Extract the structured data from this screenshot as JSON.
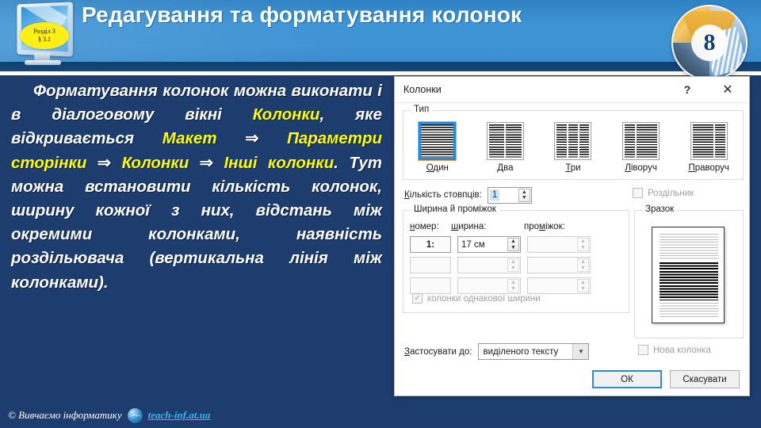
{
  "header": {
    "title": "Редагування та форматування колонок",
    "logo": {
      "line1": "Розділ 3",
      "line2": "§ 3.1"
    },
    "badge_number": "8"
  },
  "body": {
    "paragraph_plain": "Форматування колонок можна виконати і в діалоговому вікні Колонки, яке відкривається Макет ⇒ Параметри сторінки ⇒ Колонки ⇒ Інші колонки. Тут можна встановити кількість колонок, ширину кожної з них, відстань між окремими колонками, наявність роздільювача (вертикальна лінія між колонками).",
    "seg1": "Форматування колонок можна виконати і в діалоговому вікні ",
    "hl1": "Колонки",
    "seg2": ", яке відкривається ",
    "hl2": "Макет",
    "arr1": " ⇒ ",
    "hl3": "Параметри сторінки",
    "arr2": " ⇒ ",
    "hl4": "Колонки",
    "arr3": " ⇒ ",
    "hl5": "Інші колонки",
    "seg3": ". Тут можна встановити кількість колонок, ширину кожної з них, відстань між окремими колонками, наявність роздільювача (вертикальна лінія між колонками)."
  },
  "footer": {
    "copyright": "© Вивчаємо інформатику",
    "site": "teach-inf.at.ua"
  },
  "dialog": {
    "title": "Колонки",
    "help_glyph": "?",
    "close_glyph": "✕",
    "type_group_label": "Тип",
    "presets": [
      {
        "label": "Один",
        "underline": "О",
        "rest": "дин",
        "columns": 1,
        "selected": true
      },
      {
        "label": "Два",
        "underline": "Д",
        "rest": "ва",
        "columns": 2,
        "selected": false
      },
      {
        "label": "Три",
        "underline": "Т",
        "rest": "ри",
        "columns": 3,
        "selected": false
      },
      {
        "label": "Ліворуч",
        "underline": "Л",
        "rest": "іворуч",
        "columns": 2,
        "selected": false
      },
      {
        "label": "Праворуч",
        "underline": "П",
        "rest": "раворуч",
        "columns": 2,
        "selected": false
      }
    ],
    "column_count": {
      "label_underline": "К",
      "label_rest": "ількість стовпців:",
      "value": "1"
    },
    "separator_checkbox": {
      "label": "Роздільник",
      "checked": false,
      "enabled": false
    },
    "width_group_label": "Ширина й проміжок",
    "width_headers": {
      "number_u": "н",
      "number_rest": "омер:",
      "width_u": "ш",
      "width_rest": "ирина:",
      "gap_u": "про",
      "gap_mid": "м",
      "gap_rest": "іжок:"
    },
    "width_rows": [
      {
        "number": "1:",
        "width": "17 см",
        "gap": "",
        "enabled": true
      },
      {
        "number": "",
        "width": "",
        "gap": "",
        "enabled": false
      },
      {
        "number": "",
        "width": "",
        "gap": "",
        "enabled": false
      }
    ],
    "equal_width_checkbox": {
      "label": "колонки однакової ширини",
      "checked": true,
      "enabled": false
    },
    "sample_group_label": "Зразок",
    "apply_to": {
      "label_underline": "З",
      "label_rest": "астосувати до:",
      "value": "виділеного тексту"
    },
    "new_column_checkbox": {
      "label": "Нова колонка",
      "checked": false,
      "enabled": false
    },
    "ok_button": "ОК",
    "cancel_button": "Скасувати",
    "spin_up_glyph": "▲",
    "spin_down_glyph": "▼",
    "dropdown_glyph": "▼",
    "check_glyph": "✓"
  },
  "colors": {
    "header_blue": "#3e94d4",
    "body_navy": "#1d3d6e",
    "highlight_yellow": "#ffff00",
    "accent_blue": "#2a8ad4",
    "link_cyan": "#36b6ef"
  }
}
